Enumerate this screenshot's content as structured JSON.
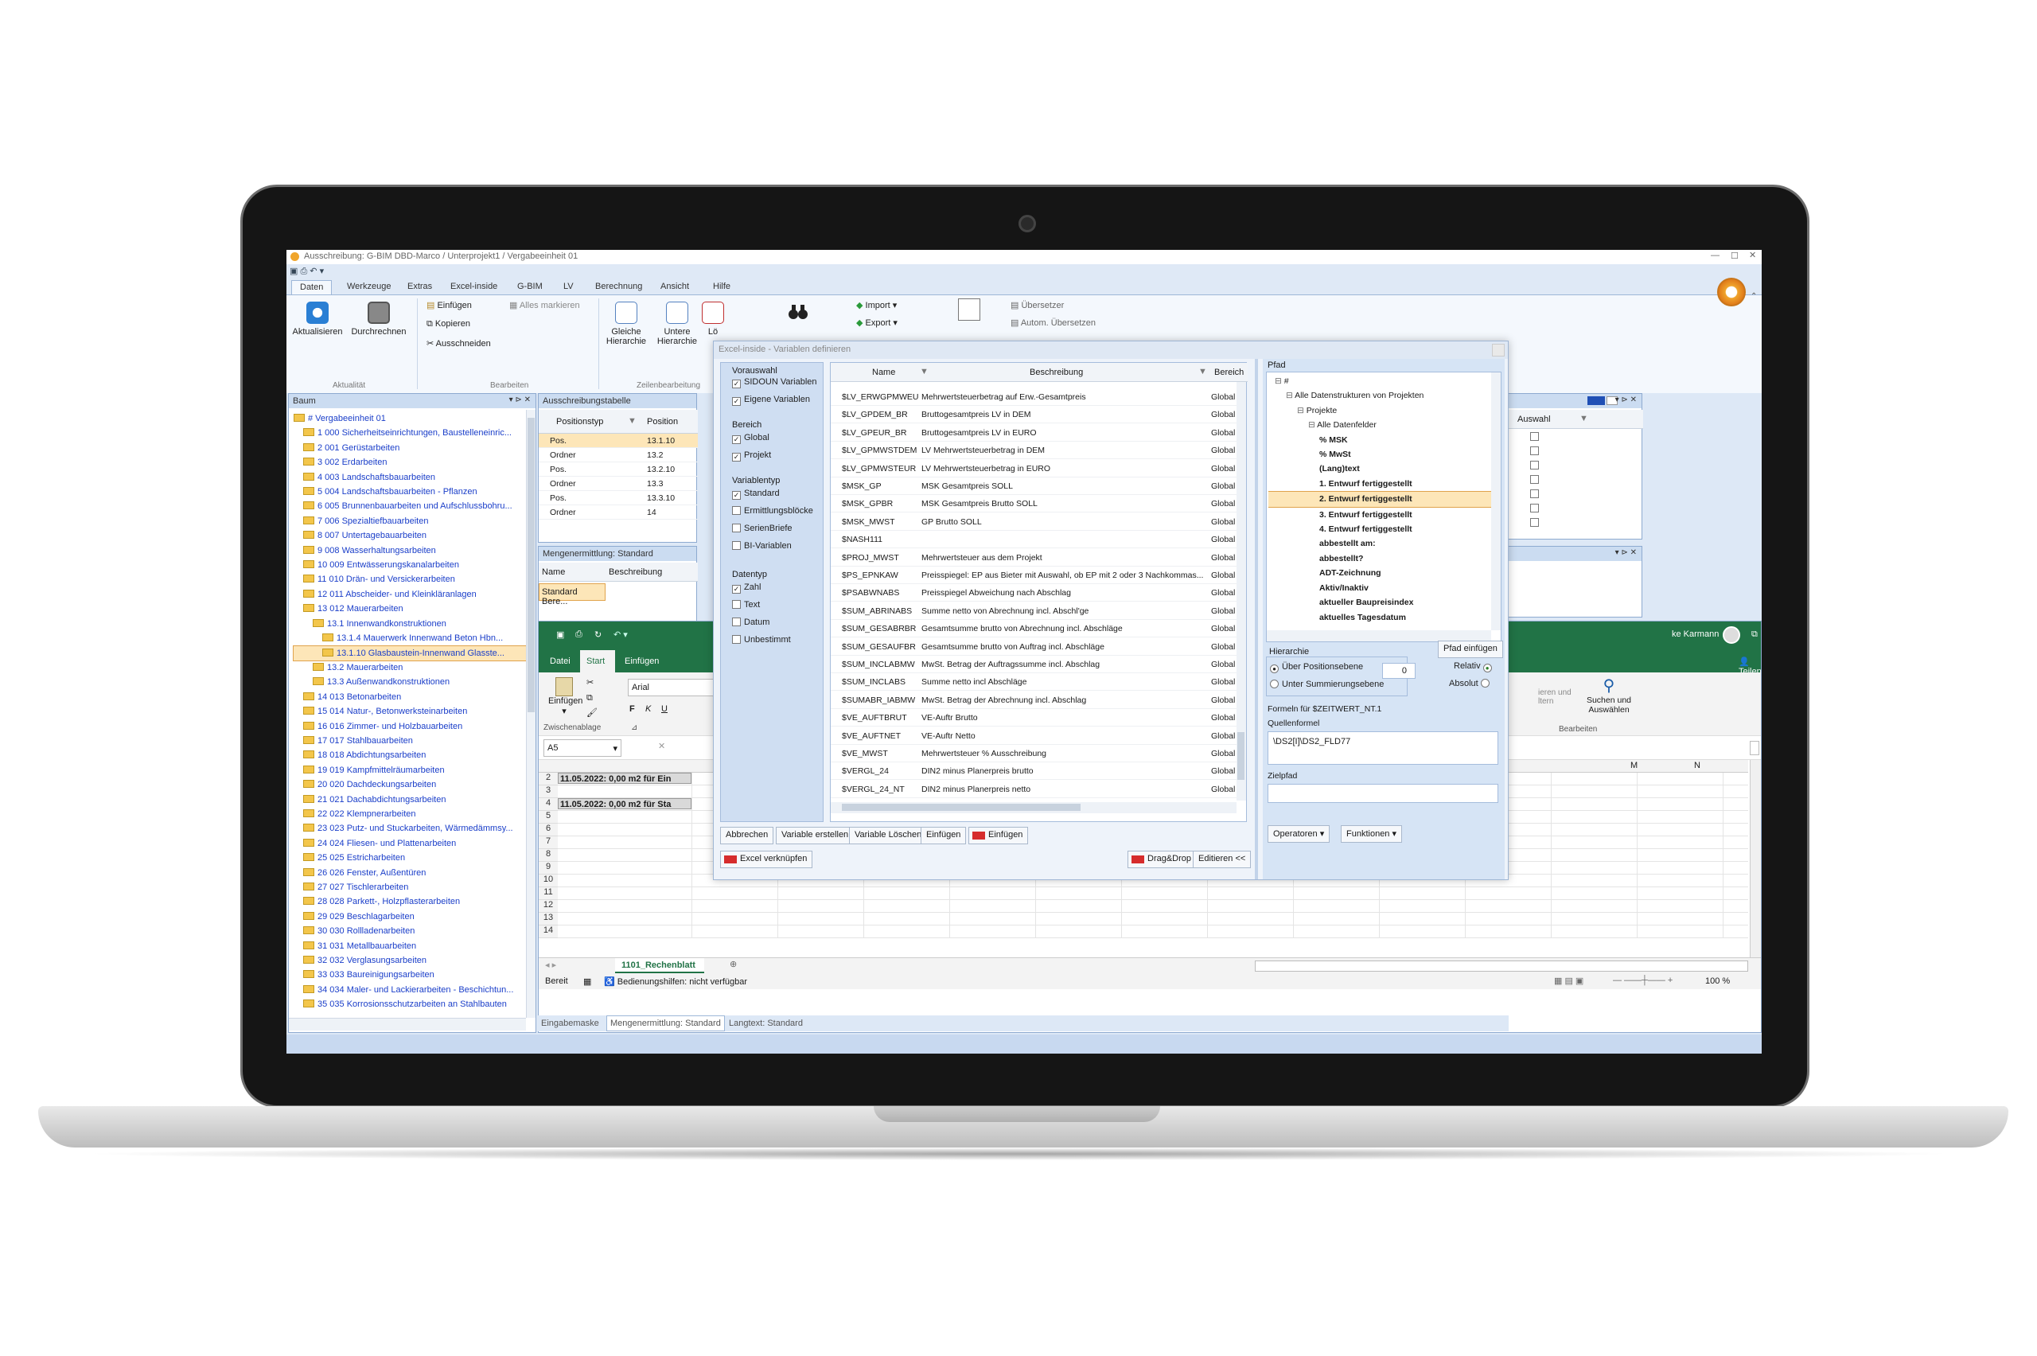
{
  "window": {
    "title": "Ausschreibung: G-BIM DBD-Marco / Unterprojekt1 / Vergabeeinheit 01"
  },
  "ribbon": {
    "tabs": [
      "Daten",
      "Werkzeuge",
      "Extras",
      "Excel-inside",
      "G-BIM",
      "LV",
      "Berechnung",
      "Ansicht",
      "Hilfe"
    ],
    "active_tab": "Daten",
    "aktualisieren": "Aktualisieren",
    "durchrechnen": "Durchrechnen",
    "group_aktualitaet": "Aktualität",
    "einfuegen": "Einfügen",
    "alles_markieren": "Alles markieren",
    "kopieren": "Kopieren",
    "ausschneiden": "Ausschneiden",
    "group_bearbeiten": "Bearbeiten",
    "gleiche_hierarchie": "Gleiche Hierarchie",
    "untere_hierarchie": "Untere Hierarchie",
    "loeschen_trunc": "Lö",
    "group_zeilenbearbeitung": "Zeilenbearbeitung",
    "import": "Import",
    "export": "Export",
    "uebersetzer": "Übersetzer",
    "autom_uebersetzen": "Autom. Übersetzen"
  },
  "tree_panel": {
    "title": "Baum",
    "items": [
      "# Vergabeeinheit 01",
      "1 000 Sicherheitseinrichtungen, Baustelleneinric...",
      "2 001 Gerüstarbeiten",
      "3 002 Erdarbeiten",
      "4 003 Landschaftsbauarbeiten",
      "5 004 Landschaftsbauarbeiten - Pflanzen",
      "6 005 Brunnenbauarbeiten und Aufschlussbohru...",
      "7 006 Spezialtiefbauarbeiten",
      "8 007 Untertagebauarbeiten",
      "9 008 Wasserhaltungsarbeiten",
      "10 009 Entwässerungskanalarbeiten",
      "11 010 Drän- und Versickerarbeiten",
      "12 011 Abscheider- und Kleinkläranlagen",
      "13 012 Mauerarbeiten",
      "13.1 Innenwandkonstruktionen",
      "13.1.4 Mauerwerk Innenwand Beton Hbn...",
      "13.1.10 Glasbaustein-Innenwand Glasste...",
      "13.2 Mauerarbeiten",
      "13.3 Außenwandkonstruktionen",
      "14 013 Betonarbeiten",
      "15 014 Natur-, Betonwerksteinarbeiten",
      "16 016 Zimmer- und Holzbauarbeiten",
      "17 017 Stahlbauarbeiten",
      "18 018 Abdichtungsarbeiten",
      "19 019 Kampfmittelräumarbeiten",
      "20 020 Dachdeckungsarbeiten",
      "21 021 Dachabdichtungsarbeiten",
      "22 022 Klempnerarbeiten",
      "23 023 Putz- und Stuckarbeiten, Wärmedämmsy...",
      "24 024 Fliesen- und Plattenarbeiten",
      "25 025 Estricharbeiten",
      "26 026 Fenster, Außentüren",
      "27 027 Tischlerarbeiten",
      "28 028 Parkett-, Holzpflasterarbeiten",
      "29 029 Beschlagarbeiten",
      "30 030 Rollladenarbeiten",
      "31 031 Metallbauarbeiten",
      "32 032 Verglasungsarbeiten",
      "33 033 Baureinigungsarbeiten",
      "34 034 Maler- und Lackierarbeiten - Beschichtun...",
      "35 035 Korrosionsschutzarbeiten an Stahlbauten"
    ]
  },
  "tender_table": {
    "title": "Ausschreibungstabelle",
    "headers": [
      "Positionstyp",
      "Position"
    ],
    "rows": [
      [
        "Pos.",
        "13.1.10"
      ],
      [
        "Ordner",
        "13.2"
      ],
      [
        "Pos.",
        "13.2.10"
      ],
      [
        "Ordner",
        "13.3"
      ],
      [
        "Pos.",
        "13.3.10"
      ],
      [
        "Ordner",
        "14"
      ]
    ]
  },
  "quantity_panel": {
    "title": "Mengenermittlung: Standard",
    "headers": [
      "Name",
      "Beschreibung"
    ],
    "row": "Standard Bere..."
  },
  "right_top_panel": {
    "header": "Auswahl"
  },
  "excel": {
    "user": "ke Karmann",
    "tabs": [
      "Datei",
      "Start",
      "Einfügen"
    ],
    "share": "Teilen",
    "paste": "Einfügen",
    "clipboard": "Zwischenablage",
    "font": "Arial",
    "bold": "F",
    "italic": "K",
    "underline": "U",
    "cell_ref": "A5",
    "search": "Suchen und Auswählen",
    "filter_trunc": "ieren und ltern",
    "group_edit": "Bearbeiten",
    "col_m": "M",
    "col_n": "N",
    "row_nums": [
      "2",
      "3",
      "4",
      "5",
      "6",
      "7",
      "8",
      "9",
      "10",
      "11",
      "12",
      "13",
      "14"
    ],
    "row2": "11.05.2022: 0,00 m2 für Ein",
    "row4": "11.05.2022: 0,00 m2 für Sta",
    "sheet_tab": "1101_Rechenblatt",
    "status_ready": "Bereit",
    "status_access": "Bedienungshilfen: nicht verfügbar",
    "zoom": "100 %"
  },
  "status_tabs": [
    "Eingabemaske",
    "Mengenermittlung: Standard",
    "Langtext: Standard"
  ],
  "dialog": {
    "title": "Excel-inside - Variablen definieren",
    "vorauswahl": "Vorauswahl",
    "vorauswahl_items": [
      "SIDOUN Variablen",
      "Eigene Variablen"
    ],
    "bereich": "Bereich",
    "bereich_items": [
      "Global",
      "Projekt"
    ],
    "variablentyp": "Variablentyp",
    "variablentyp_items": [
      "Standard",
      "Ermittlungsblöcke",
      "SerienBriefe",
      "BI-Variablen"
    ],
    "datentyp": "Datentyp",
    "datentyp_items": [
      "Zahl",
      "Text",
      "Datum",
      "Unbestimmt"
    ],
    "grid_headers": [
      "Name",
      "Beschreibung",
      "Bereich"
    ],
    "grid_rows": [
      [
        "$LV_ERWGPMWEU",
        "Mehrwertsteuerbetrag auf Erw.-Gesamtpreis",
        "Global ("
      ],
      [
        "$LV_GPDEM_BR",
        "Bruttogesamtpreis LV in DEM",
        "Global ("
      ],
      [
        "$LV_GPEUR_BR",
        "Bruttogesamtpreis LV in EURO",
        "Global ("
      ],
      [
        "$LV_GPMWSTDEM",
        "LV Mehrwertsteuerbetrag in DEM",
        "Global ("
      ],
      [
        "$LV_GPMWSTEUR",
        "LV Mehrwertsteuerbetrag in EURO",
        "Global ("
      ],
      [
        "$MSK_GP",
        "MSK Gesamtpreis SOLL",
        "Global ("
      ],
      [
        "$MSK_GPBR",
        "MSK Gesamtpreis Brutto SOLL",
        "Global ("
      ],
      [
        "$MSK_MWST",
        "GP Brutto SOLL",
        "Global ("
      ],
      [
        "$NASH111",
        "",
        "Global ("
      ],
      [
        "$PROJ_MWST",
        "Mehrwertsteuer aus dem Projekt",
        "Global ("
      ],
      [
        "$PS_EPNKAW",
        "Preisspiegel: EP aus Bieter mit Auswahl, ob EP mit 2 oder 3 Nachkommas...",
        "Global ("
      ],
      [
        "$PSABWNABS",
        "Preisspiegel Abweichung nach Abschlag",
        "Global ("
      ],
      [
        "$SUM_ABRINABS",
        "Summe netto von Abrechnung incl. Abschl'ge",
        "Global ("
      ],
      [
        "$SUM_GESABRBR",
        "Gesamtsumme brutto von Abrechnung incl. Abschläge",
        "Global ("
      ],
      [
        "$SUM_GESAUFBR",
        "Gesamtsumme brutto von Auftrag incl. Abschläge",
        "Global ("
      ],
      [
        "$SUM_INCLABMW",
        "MwSt. Betrag der Auftragssumme incl. Abschlag",
        "Global ("
      ],
      [
        "$SUM_INCLABS",
        "Summe netto incl Abschläge",
        "Global ("
      ],
      [
        "$SUMABR_IABMW",
        "MwSt. Betrag der Abrechnung incl. Abschlag",
        "Global ("
      ],
      [
        "$VE_AUFTBRUT",
        "VE-Auftr Brutto",
        "Global ("
      ],
      [
        "$VE_AUFTNET",
        "VE-Auftr Netto",
        "Global ("
      ],
      [
        "$VE_MWST",
        "Mehrwertsteuer % Ausschreibung",
        "Global ("
      ],
      [
        "$VERGL_24",
        "DIN2 minus Planerpreis brutto",
        "Global ("
      ],
      [
        "$VERGL_24_NT",
        "DIN2 minus Planerpreis netto",
        "Global ("
      ]
    ],
    "buttons_row1": [
      "Abbrechen",
      "Variable erstellen",
      "Variable Löschen",
      "Einfügen",
      "Einfügen"
    ],
    "excel_link": "Excel verknüpfen",
    "dragdrop": "Drag&Drop <<",
    "edit": "Editieren <<",
    "pfad": "Pfad",
    "path_tree": [
      "#",
      "Alle Datenstrukturen von Projekten",
      "Projekte",
      "Alle Datenfelder",
      "% MSK",
      "% MwSt",
      "(Lang)text",
      "1. Entwurf fertiggestellt",
      "2. Entwurf fertiggestellt",
      "3. Entwurf fertiggestellt",
      "4. Entwurf fertiggestellt",
      "abbestellt am:",
      "abbestellt?",
      "ADT-Zeichnung",
      "Aktiv/Inaktiv",
      "aktueller Baupreisindex",
      "aktuelles Tagesdatum"
    ],
    "hierarchie": "Hierarchie",
    "ueber_positionsebene": "Über Positionsebene",
    "unter_summierungsebene": "Unter Summierungsebene",
    "spin_value": "0",
    "pfad_einfuegen": "Pfad einfügen",
    "relativ": "Relativ",
    "absolut": "Absolut",
    "formeln_label": "Formeln für $ZEITWERT_NT.1",
    "quellformel": "Quellenformel",
    "quellformel_value": "\\DS2[I]\\DS2_FLD77",
    "zielpfad": "Zielpfad",
    "operatoren": "Operatoren",
    "funktionen": "Funktionen"
  },
  "colors": {
    "ribbon_bg": "#dfe9f6",
    "excel_green": "#217346",
    "tree_blue": "#1a3ec9",
    "highlight": "#fde6b8"
  }
}
